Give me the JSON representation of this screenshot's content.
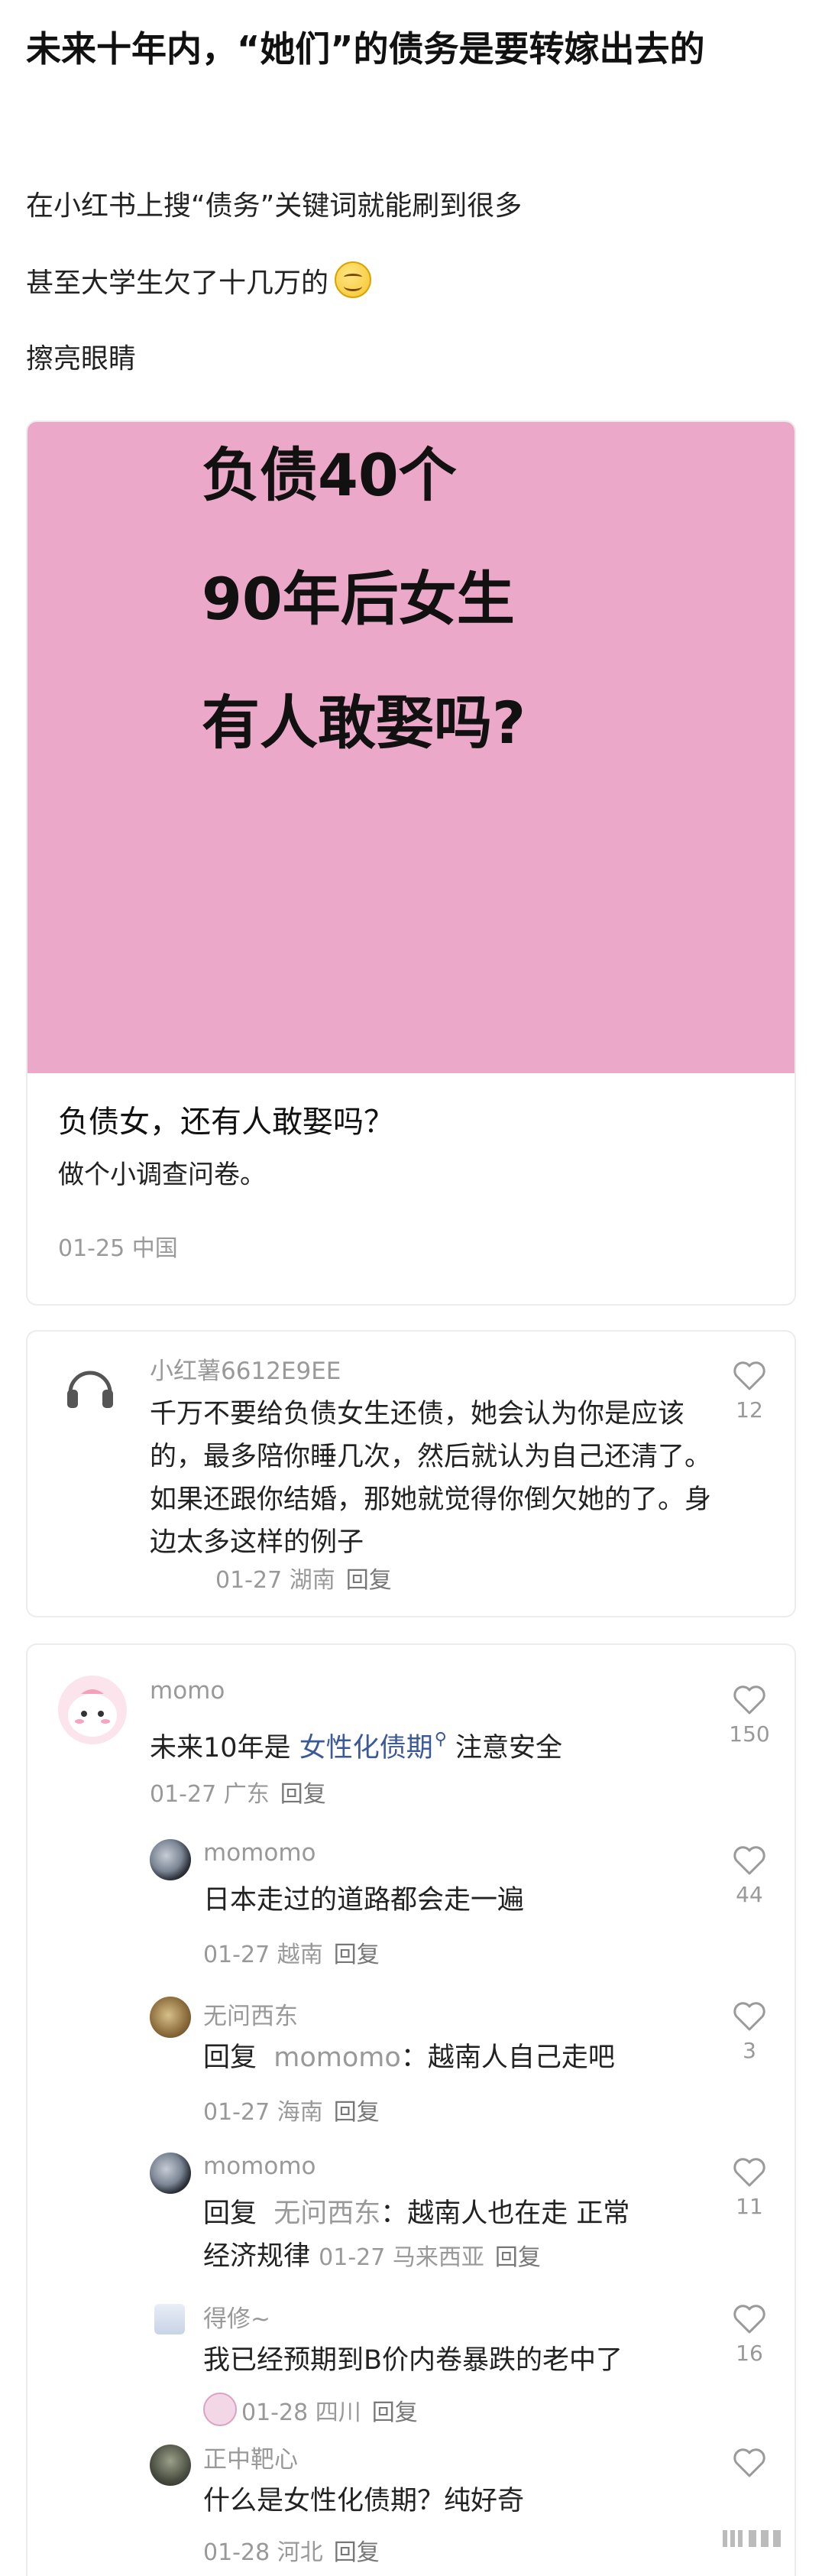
{
  "post": {
    "title": "未来十年内，“她们”的债务是要转嫁出去的",
    "lines": [
      "在小红书上搜“债务”关键词就能刷到很多",
      "甚至大学生欠了十几万的",
      "擦亮眼睛"
    ]
  },
  "card": {
    "image_lines": [
      "负债40个",
      "90年后女生",
      "有人敢娶吗?"
    ],
    "title": "负债女，还有人敢娶吗？",
    "subtitle": "做个小调查问卷。",
    "meta": "01-25 中国"
  },
  "comment1": {
    "name": "小红薯6612E9EE",
    "text": "千万不要给负债女生还债，她会认为你是应该的，最多陪你睡几次，然后就认为自己还清了。如果还跟你结婚，那她就觉得你倒欠她的了。身边太多这样的例子",
    "meta": "01-27 湖南",
    "reply": "回复",
    "likes": "12"
  },
  "thread": {
    "main": {
      "name": "momo",
      "text_before": "未来10年是",
      "keyword": "女性化债期",
      "text_after": "注意安全",
      "meta": "01-27 广东",
      "reply": "回复",
      "likes": "150"
    },
    "replies": [
      {
        "name": "momomo",
        "text": "日本走过的道路都会走一遍",
        "meta": "01-27 越南",
        "reply": "回复",
        "likes": "44"
      },
      {
        "name": "无问西东",
        "prefix": "回复",
        "target": "momomo",
        "text": "：越南人自己走吧",
        "meta": "01-27 海南",
        "reply": "回复",
        "likes": "3"
      },
      {
        "name": "momomo",
        "prefix": "回复",
        "target": "无问西东",
        "text_line1": "：越南人也在走 正常",
        "text_line2": "经济规律",
        "meta": "01-27 马来西亚",
        "reply": "回复",
        "likes": "11"
      },
      {
        "name": "得修~",
        "text": "我已经预期到B价内卷暴跌的老中了",
        "meta": "01-28 四川",
        "reply": "回复",
        "likes": "16"
      },
      {
        "name": "正中靶心",
        "text": "什么是女性化债期？纯好奇",
        "meta": "01-28 河北",
        "reply": "回复",
        "likes": ""
      }
    ]
  },
  "colors": {
    "pink_bg": "#eba8c8",
    "link": "#3b5998",
    "muted": "#999999"
  }
}
